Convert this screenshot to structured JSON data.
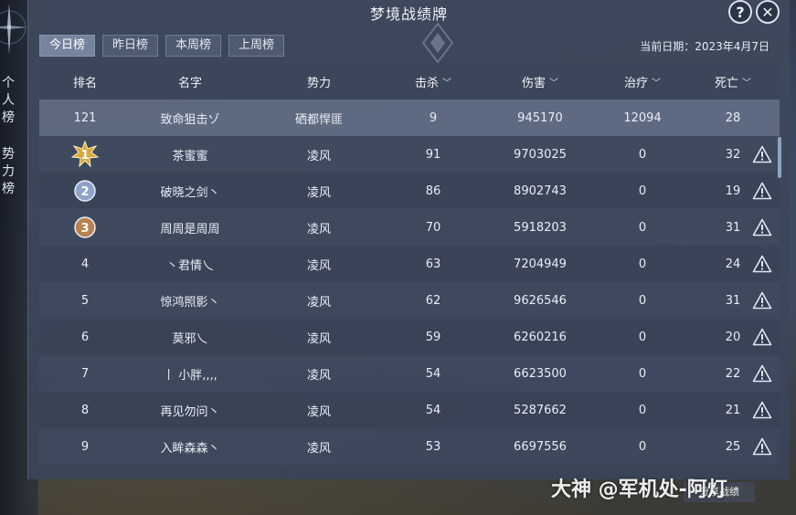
{
  "window": {
    "title": "梦境战绩牌",
    "help_symbol": "?",
    "close_symbol": "✕"
  },
  "left_tabs": [
    {
      "label": [
        "个",
        "人",
        "榜"
      ]
    },
    {
      "label": [
        "势",
        "力",
        "榜"
      ]
    }
  ],
  "tabs": [
    {
      "label": "今日榜",
      "active": true
    },
    {
      "label": "昨日榜",
      "active": false
    },
    {
      "label": "本周榜",
      "active": false
    },
    {
      "label": "上周榜",
      "active": false
    }
  ],
  "date_label": "当前日期：2023年4月7日",
  "columns": {
    "rank": "排名",
    "name": "名字",
    "force": "势力",
    "kills": "击杀",
    "damage": "伤害",
    "heal": "治疗",
    "deaths": "死亡"
  },
  "self_row": {
    "rank": "121",
    "name": "致命狙击ゾ",
    "force": "硒都悍匪",
    "kills": "9",
    "damage": "945170",
    "heal": "12094",
    "deaths": "28"
  },
  "rows": [
    {
      "rank": "1",
      "name": "茶蜜蜜",
      "force": "凌风",
      "kills": "91",
      "damage": "9703025",
      "heal": "0",
      "deaths": "32"
    },
    {
      "rank": "2",
      "name": "破晓之剑丶",
      "force": "凌风",
      "kills": "86",
      "damage": "8902743",
      "heal": "0",
      "deaths": "19"
    },
    {
      "rank": "3",
      "name": "周周是周周",
      "force": "凌风",
      "kills": "70",
      "damage": "5918203",
      "heal": "0",
      "deaths": "31"
    },
    {
      "rank": "4",
      "name": "丶君情乀",
      "force": "凌风",
      "kills": "63",
      "damage": "7204949",
      "heal": "0",
      "deaths": "24"
    },
    {
      "rank": "5",
      "name": "惊鸿照影丶",
      "force": "凌风",
      "kills": "62",
      "damage": "9626546",
      "heal": "0",
      "deaths": "31"
    },
    {
      "rank": "6",
      "name": "莫邪乀",
      "force": "凌风",
      "kills": "59",
      "damage": "6260216",
      "heal": "0",
      "deaths": "20"
    },
    {
      "rank": "7",
      "name": "丨 小胖,,,,",
      "force": "凌风",
      "kills": "54",
      "damage": "6623500",
      "heal": "0",
      "deaths": "22"
    },
    {
      "rank": "8",
      "name": "再见勿问丶",
      "force": "凌风",
      "kills": "54",
      "damage": "5287662",
      "heal": "0",
      "deaths": "21"
    },
    {
      "rank": "9",
      "name": "入眸森森丶",
      "force": "凌风",
      "kills": "53",
      "damage": "6697556",
      "heal": "0",
      "deaths": "25"
    }
  ],
  "medal_colors": {
    "gold": "#d8a83c",
    "silver": "#8ea4c8",
    "bronze": "#b9814f"
  },
  "icons": {
    "sort": "chevron-down-icon",
    "report": "warning-triangle-icon"
  },
  "watermark": "大神 @军机处-阿灯",
  "bottom_button": "分享战绩"
}
